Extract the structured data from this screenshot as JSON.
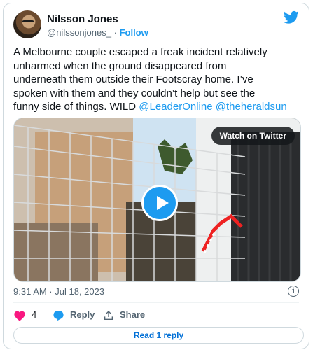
{
  "author": {
    "name": "Nilsson Jones",
    "handle": "@nilssonjones_",
    "separator": "·",
    "follow_label": "Follow"
  },
  "tweet": {
    "text_lines": [
      "A Melbourne couple escaped a freak incident relatively",
      "unharmed when the ground disappeared from",
      "underneath them outside their Footscray home. I’ve",
      "spoken with them and they couldn’t help but see the",
      "funny side of things. WILD "
    ],
    "mention_1": "@LeaderOnline",
    "mention_2": "@theheraldsun"
  },
  "media": {
    "watch_label": "Watch on Twitter",
    "icon": "play-icon"
  },
  "timestamp": "9:31 AM · Jul 18, 2023",
  "actions": {
    "like_count": "4",
    "reply_label": "Reply",
    "share_label": "Share"
  },
  "read_replies_label": "Read 1 reply",
  "colors": {
    "accent": "#1d9bf0",
    "like": "#f91880",
    "text": "#0f1419",
    "muted": "#536471"
  }
}
